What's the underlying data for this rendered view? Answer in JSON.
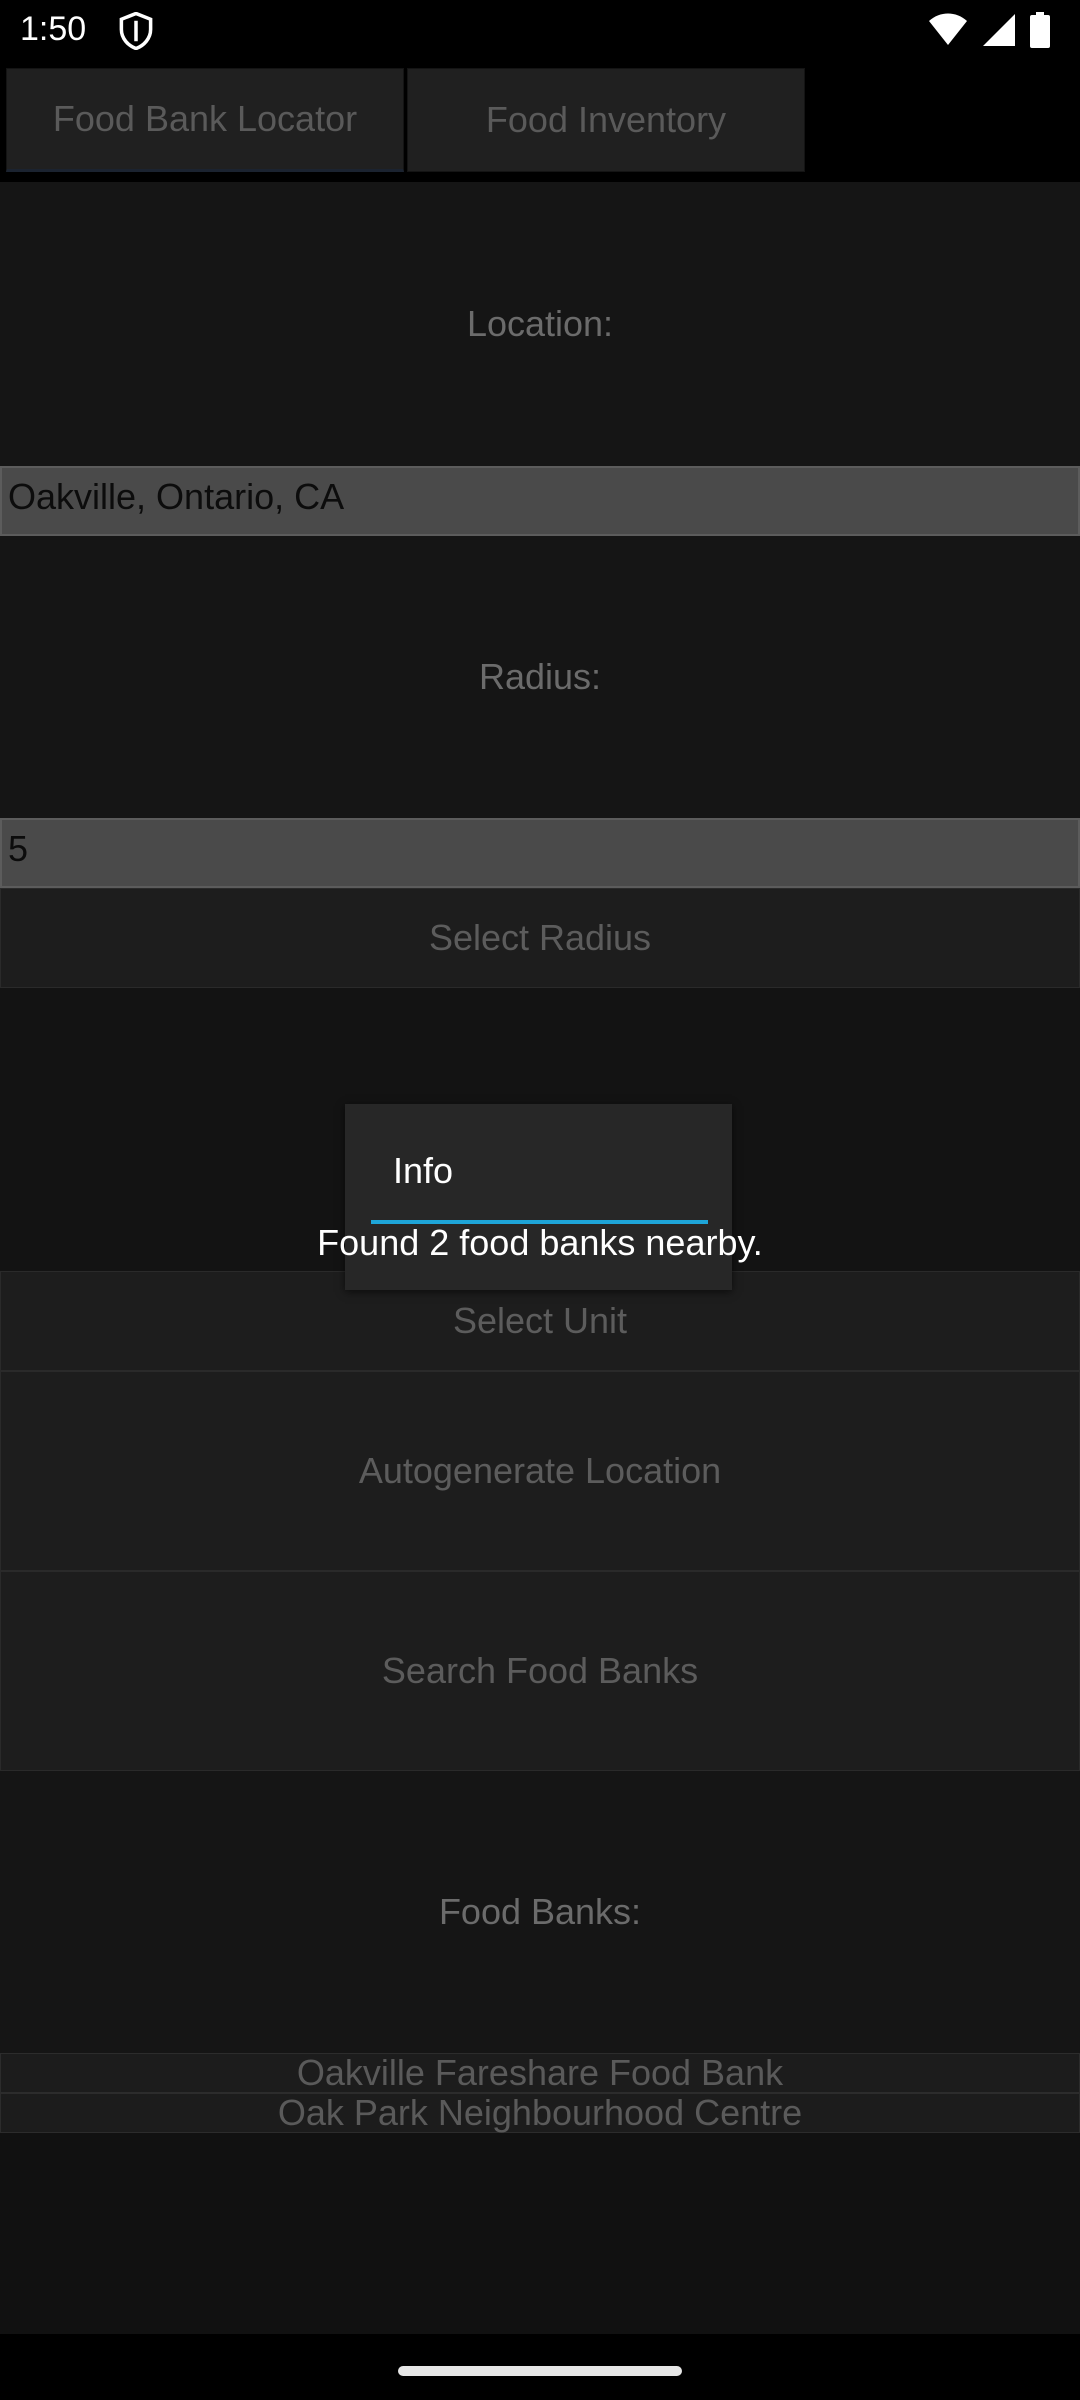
{
  "status_bar": {
    "time": "1:50",
    "icons": [
      "shield-icon",
      "wifi-icon",
      "signal-icon",
      "battery-icon"
    ]
  },
  "tabs": [
    {
      "label": "Food Bank Locator",
      "active": true
    },
    {
      "label": "Food Inventory",
      "active": false
    }
  ],
  "form": {
    "location_label": "Location:",
    "location_value": "Oakville, Ontario, CA",
    "radius_label": "Radius:",
    "radius_value": "5",
    "select_radius_label": "Select Radius",
    "select_unit_label": "Select Unit",
    "autogenerate_label": "Autogenerate Location",
    "search_label": "Search Food Banks"
  },
  "results": {
    "heading": "Food Banks:",
    "items": [
      "Oakville Fareshare Food Bank",
      "Oak Park Neighbourhood Centre"
    ]
  },
  "dialog": {
    "title": "Info",
    "message": "Found 2 food banks nearby.",
    "accent_color": "#1ea5d8"
  }
}
